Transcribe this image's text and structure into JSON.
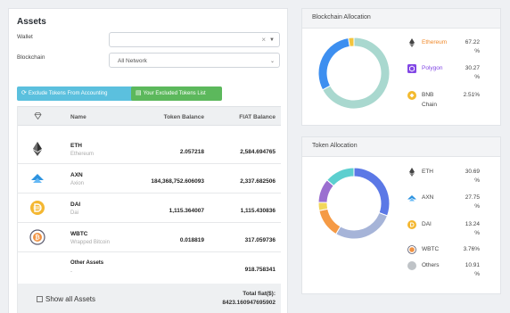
{
  "assets": {
    "title": "Assets",
    "wallet_label": "Wallet",
    "wallet_value": "",
    "blockchain_label": "Blockchain",
    "blockchain_value": "All Network",
    "exclude_button": "Exclude Tokens From Accounting",
    "excluded_list_button": "Your Excluded Tokens List",
    "table": {
      "col_name": "Name",
      "col_balance": "Token Balance",
      "col_fiat": "FIAT Balance",
      "rows": [
        {
          "symbol": "ETH",
          "name": "Ethereum",
          "balance": "2.057218",
          "fiat": "2,584.694765",
          "icon": "ethereum-icon"
        },
        {
          "symbol": "AXN",
          "name": "Axion",
          "balance": "184,368,752.606093",
          "fiat": "2,337.682506",
          "icon": "axion-icon"
        },
        {
          "symbol": "DAI",
          "name": "Dai",
          "balance": "1,115.364007",
          "fiat": "1,115.430836",
          "icon": "dai-icon"
        },
        {
          "symbol": "WBTC",
          "name": "Wrapped Bitcoin",
          "balance": "0.018819",
          "fiat": "317.059736",
          "icon": "wbtc-icon"
        }
      ],
      "other": {
        "symbol": "Other Assets",
        "name": "-",
        "balance": "",
        "fiat": "918.758341"
      },
      "show_all_label": "Show all Assets",
      "total_label": "Total fiat($):",
      "total_value": "8423.160947695902"
    }
  },
  "blockchain_allocation": {
    "title": "Blockchain Allocation",
    "items": [
      {
        "name": "Ethereum",
        "pct": "67.22",
        "unit": "%",
        "value": 67.22,
        "color": "#a9d8cf",
        "icon": "ethereum-icon"
      },
      {
        "name": "Polygon",
        "pct": "30.27",
        "unit": "%",
        "value": 30.27,
        "color": "#3d8ff0",
        "icon": "polygon-icon"
      },
      {
        "name": "BNB",
        "name2": "Chain",
        "pct": "2.51%",
        "unit": "",
        "value": 2.51,
        "color": "#f3c43c",
        "icon": "bnb-icon"
      }
    ]
  },
  "token_allocation": {
    "title": "Token Allocation",
    "items": [
      {
        "name": "ETH",
        "pct": "30.69",
        "unit": "%",
        "value": 30.69,
        "color": "#5b78e6",
        "icon": "ethereum-icon"
      },
      {
        "name": "AXN",
        "pct": "27.75",
        "unit": "%",
        "value": 27.75,
        "color": "#a6b4d8",
        "icon": "axion-icon"
      },
      {
        "name": "DAI",
        "pct": "13.24",
        "unit": "%",
        "value": 13.24,
        "color": "#f59a45",
        "icon": "dai-icon"
      },
      {
        "name": "WBTC",
        "pct": "3.76%",
        "unit": "",
        "value": 3.76,
        "color": "#f2d75b",
        "icon": "wbtc-icon"
      },
      {
        "name": "Others",
        "pct": "10.91",
        "unit": "%",
        "value": 10.91,
        "color": "#9b6fd0",
        "icon": "others-icon"
      },
      {
        "name": "",
        "pct": "",
        "unit": "",
        "value": 13.65,
        "color": "#5ccfcf",
        "icon": ""
      }
    ]
  }
}
